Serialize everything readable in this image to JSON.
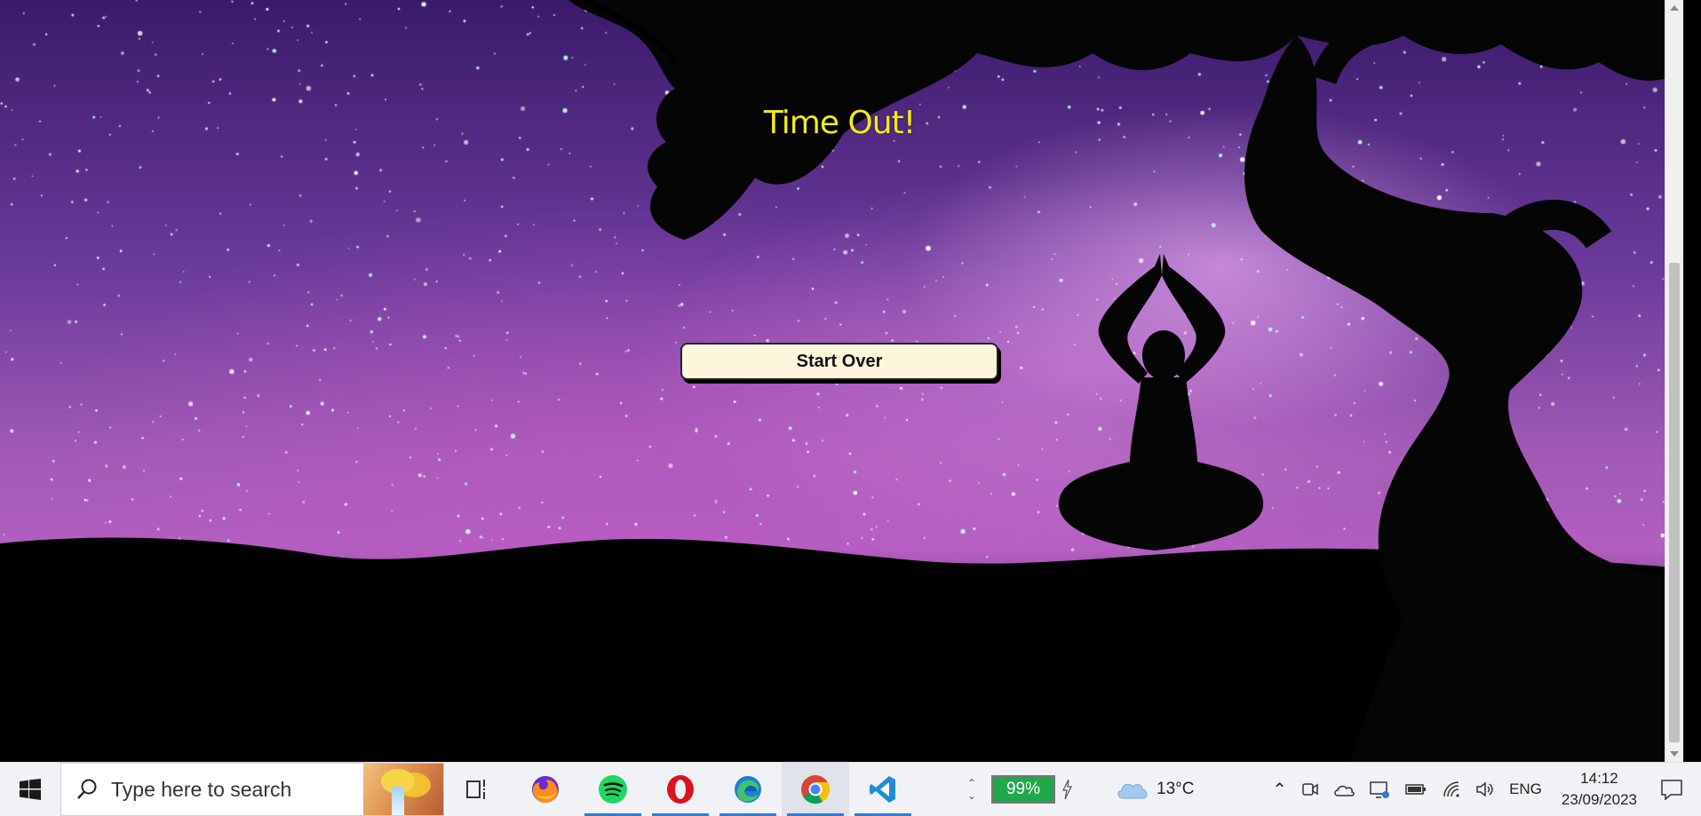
{
  "page": {
    "title": "Time Out!",
    "start_over_label": "Start Over"
  },
  "taskbar": {
    "search_placeholder": "Type here to search",
    "apps": [
      {
        "name": "task-view-icon"
      },
      {
        "name": "firefox-icon"
      },
      {
        "name": "spotify-icon"
      },
      {
        "name": "opera-icon"
      },
      {
        "name": "edge-icon"
      },
      {
        "name": "chrome-icon"
      },
      {
        "name": "vscode-icon"
      }
    ],
    "battery_percent": "99%",
    "weather_temp": "13°C",
    "language": "ENG",
    "time": "14:12",
    "date": "23/09/2023"
  },
  "colors": {
    "title": "#f2ea16",
    "button_bg": "#fdf6dd",
    "battery": "#1fa84c",
    "taskbar_bg": "#f1f2f6"
  }
}
